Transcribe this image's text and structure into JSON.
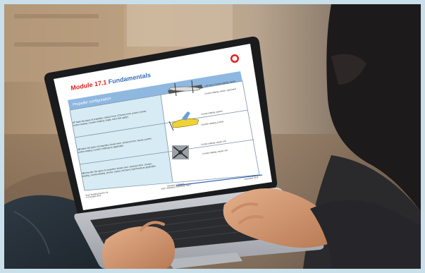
{
  "slide": {
    "module": "Module 17.1",
    "title": "Fundamentals",
    "section": "Propeller configuration",
    "rows": [
      {
        "num": "17",
        "question": "State the types of propellers (Select here: (Choose from: pusher, tractor, contra-rotating, counter-rotating, single, twin) that apply)."
      },
      {
        "num": "18",
        "question": "Name the types of propellers shown here: (Choose from: tractor, pusher, contra-rotating, counter-rotating) as applicable."
      },
      {
        "num": "19",
        "question": "Describe the types of propellers shown here: (Choose from: counter-rotating, contra-rotating, pusher, tractor, left hand, right hand) as applicable."
      }
    ],
    "answers": [
      [
        "Left hand, Contra-rotating, tractor",
        "Contra-rotating, tractor, right hand"
      ],
      [
        "Contra-rotating, pusher",
        "Counter-rotating, pusher"
      ],
      [
        "Contra-rotating, tractor, left",
        "Contra-rotating, tractor, left"
      ]
    ],
    "footer_left": [
      "Team Building Experts Ltd",
      "© Copyright 2018"
    ],
    "footer_center": [
      "Selection 1: Page 8",
      "FOR TRAINING PURPOSE ONLY"
    ],
    "footer_right": [
      "Issue 2",
      "December 2018"
    ]
  },
  "colors": {
    "slide_bg": "#ffffff",
    "header_band": "#8fb8e0",
    "left_column": "#d6ebf3",
    "title_red": "#e2211c",
    "title_blue": "#3a6fb5",
    "laptop_body": "#bfc3c8",
    "keyboard": "#2a2c30"
  }
}
